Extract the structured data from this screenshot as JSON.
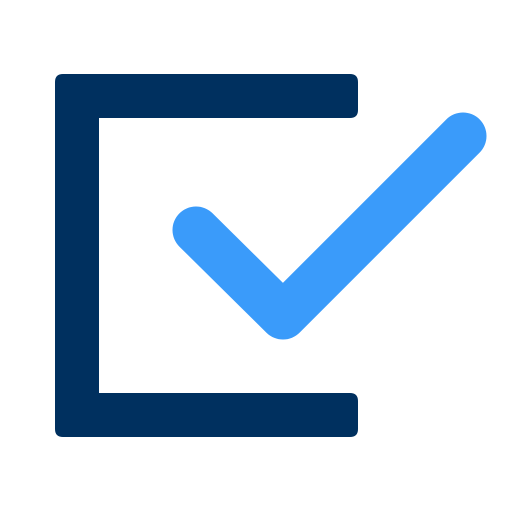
{
  "icon": {
    "name": "checkbox-checked-icon",
    "colors": {
      "frame": "#00305F",
      "check": "#3A9BFA",
      "background": "#FFFFFF"
    }
  }
}
